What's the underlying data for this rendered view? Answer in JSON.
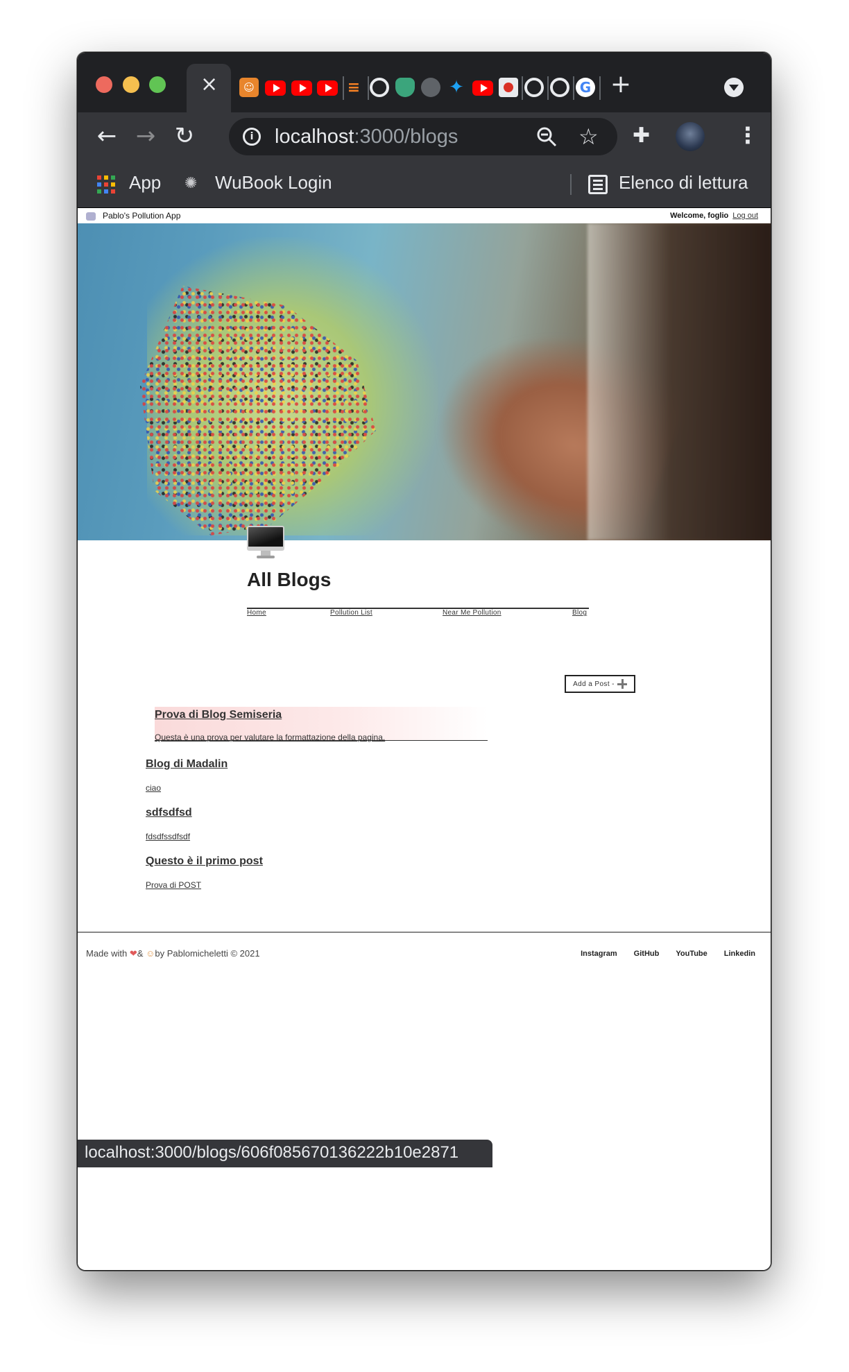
{
  "browser": {
    "tab_close_glyph": "×",
    "new_tab_glyph": "+",
    "url_host": "localhost",
    "url_path": ":3000/blogs",
    "bookmarks": [
      {
        "label": "App",
        "icon": "apps-grid-icon"
      },
      {
        "label": "WuBook Login",
        "icon": "wubook-icon"
      }
    ],
    "reading_list_label": "Elenco di lettura",
    "status_url": "localhost:3000/blogs/606f085670136222b10e2871"
  },
  "site": {
    "name": "Pablo's Pollution App",
    "welcome_label": "Welcome, foglio",
    "logout_label": "Log out",
    "page_title": "All Blogs",
    "nav": [
      "Home",
      "Pollution List",
      "Near Me Pollution",
      "Blog"
    ],
    "add_post_label": "Add a Post -",
    "posts": [
      {
        "title": "Prova di Blog Semiseria",
        "excerpt": "Questa è una prova per valutare la formattazione della pagina."
      },
      {
        "title": "Blog di Madalin",
        "excerpt": "ciao"
      },
      {
        "title": "sdfsdfsd",
        "excerpt": "fdsdfssdfsdf"
      },
      {
        "title": "Questo è il primo post",
        "excerpt": "Prova di POST"
      }
    ],
    "footer": {
      "made_with_prefix": "Made with",
      "heart_glyph": "❤",
      "amp": "&",
      "face_glyph": "☺",
      "made_with_suffix": "by Pablomicheletti © 2021",
      "links": [
        "Instagram",
        "GitHub",
        "YouTube",
        "Linkedin"
      ]
    }
  },
  "colors": {
    "tab_strip": "#202124",
    "toolbar": "#35363a",
    "featured_post_highlight": "#fadada"
  }
}
